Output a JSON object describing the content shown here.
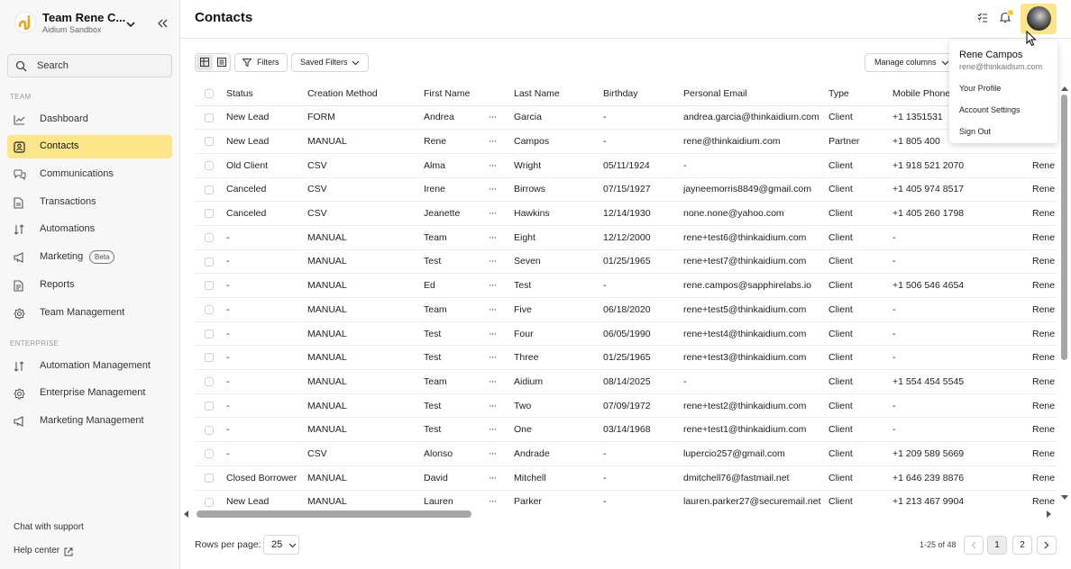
{
  "sidebar": {
    "team_name": "Team Rene C...",
    "team_sub": "Aidium Sandbox",
    "search_placeholder": "Search",
    "section_team": "TEAM",
    "section_enterprise": "ENTERPRISE",
    "items": [
      {
        "label": "Dashboard",
        "icon": "chart-line-icon"
      },
      {
        "label": "Contacts",
        "icon": "contacts-icon",
        "active": true
      },
      {
        "label": "Communications",
        "icon": "chat-icon"
      },
      {
        "label": "Transactions",
        "icon": "document-icon"
      },
      {
        "label": "Automations",
        "icon": "automation-icon"
      },
      {
        "label": "Marketing",
        "icon": "megaphone-icon",
        "badge": "Beta"
      },
      {
        "label": "Reports",
        "icon": "report-icon"
      },
      {
        "label": "Team Management",
        "icon": "gear-icon"
      }
    ],
    "enterprise_items": [
      {
        "label": "Automation Management",
        "icon": "automation-icon"
      },
      {
        "label": "Enterprise Management",
        "icon": "gear-icon"
      },
      {
        "label": "Marketing Management",
        "icon": "megaphone-icon"
      }
    ],
    "chat_support": "Chat with support",
    "help_center": "Help center"
  },
  "header": {
    "title": "Contacts"
  },
  "toolbar": {
    "filters": "Filters",
    "saved_filters": "Saved Filters",
    "manage_columns": "Manage columns"
  },
  "table": {
    "columns": [
      "Status",
      "Creation Method",
      "First Name",
      "Last Name",
      "Birthday",
      "Personal Email",
      "Type",
      "Mobile Phone"
    ],
    "rows": [
      {
        "status": "New Lead",
        "method": "FORM",
        "first": "Andrea",
        "last": "Garcia",
        "birthday": "-",
        "email": "andrea.garcia@thinkaidium.com",
        "type": "Client",
        "phone": "+1 1351531",
        "extra": ""
      },
      {
        "status": "New Lead",
        "method": "MANUAL",
        "first": "Rene",
        "last": "Campos",
        "birthday": "-",
        "email": "rene@thinkaidium.com",
        "type": "Partner",
        "phone": "+1 805 400",
        "extra": ""
      },
      {
        "status": "Old Client",
        "method": "CSV",
        "first": "Alma",
        "last": "Wright",
        "birthday": "05/11/1924",
        "email": "-",
        "type": "Client",
        "phone": "+1 918 521 2070",
        "extra": "Rene"
      },
      {
        "status": "Canceled",
        "method": "CSV",
        "first": "Irene",
        "last": "Birrows",
        "birthday": "07/15/1927",
        "email": "jayneemorris8849@gmail.com",
        "type": "Client",
        "phone": "+1 405 974 8517",
        "extra": "Rene"
      },
      {
        "status": "Canceled",
        "method": "CSV",
        "first": "Jeanette",
        "last": "Hawkins",
        "birthday": "12/14/1930",
        "email": "none.none@yahoo.com",
        "type": "Client",
        "phone": "+1 405 260 1798",
        "extra": "Rene"
      },
      {
        "status": "-",
        "method": "MANUAL",
        "first": "Team",
        "last": "Eight",
        "birthday": "12/12/2000",
        "email": "rene+test6@thinkaidium.com",
        "type": "Client",
        "phone": "-",
        "extra": "Rene"
      },
      {
        "status": "-",
        "method": "MANUAL",
        "first": "Test",
        "last": "Seven",
        "birthday": "01/25/1965",
        "email": "rene+test7@thinkaidium.com",
        "type": "Client",
        "phone": "-",
        "extra": "Rene"
      },
      {
        "status": "-",
        "method": "MANUAL",
        "first": "Ed",
        "last": "Test",
        "birthday": "-",
        "email": "rene.campos@sapphirelabs.io",
        "type": "Client",
        "phone": "+1 506 546 4654",
        "extra": "Rene"
      },
      {
        "status": "-",
        "method": "MANUAL",
        "first": "Team",
        "last": "Five",
        "birthday": "06/18/2020",
        "email": "rene+test5@thinkaidium.com",
        "type": "Client",
        "phone": "-",
        "extra": "Rene"
      },
      {
        "status": "-",
        "method": "MANUAL",
        "first": "Test",
        "last": "Four",
        "birthday": "06/05/1990",
        "email": "rene+test4@thinkaidium.com",
        "type": "Client",
        "phone": "-",
        "extra": "Rene"
      },
      {
        "status": "-",
        "method": "MANUAL",
        "first": "Test",
        "last": "Three",
        "birthday": "01/25/1965",
        "email": "rene+test3@thinkaidium.com",
        "type": "Client",
        "phone": "-",
        "extra": "Rene"
      },
      {
        "status": "-",
        "method": "MANUAL",
        "first": "Team",
        "last": "Aidium",
        "birthday": "08/14/2025",
        "email": "-",
        "type": "Client",
        "phone": "+1 554 454 5545",
        "extra": "Rene"
      },
      {
        "status": "-",
        "method": "MANUAL",
        "first": "Test",
        "last": "Two",
        "birthday": "07/09/1972",
        "email": "rene+test2@thinkaidium.com",
        "type": "Client",
        "phone": "-",
        "extra": "Rene"
      },
      {
        "status": "-",
        "method": "MANUAL",
        "first": "Test",
        "last": "One",
        "birthday": "03/14/1968",
        "email": "rene+test1@thinkaidium.com",
        "type": "Client",
        "phone": "-",
        "extra": "Rene"
      },
      {
        "status": "-",
        "method": "CSV",
        "first": "Alonso",
        "last": "Andrade",
        "birthday": "-",
        "email": "lupercio257@gmail.com",
        "type": "Client",
        "phone": "+1 209 589 5669",
        "extra": "Rene"
      },
      {
        "status": "Closed Borrower",
        "method": "MANUAL",
        "first": "David",
        "last": "Mitchell",
        "birthday": "-",
        "email": "dmitchell76@fastmail.net",
        "type": "Client",
        "phone": "+1 646 239 8876",
        "extra": "Rene"
      },
      {
        "status": "New Lead",
        "method": "MANUAL",
        "first": "Lauren",
        "last": "Parker",
        "birthday": "-",
        "email": "lauren.parker27@securemail.net",
        "type": "Client",
        "phone": "+1 213 467 9904",
        "extra": "Rene"
      }
    ]
  },
  "footer": {
    "rows_per_page_label": "Rows per page:",
    "rows_per_page": "25",
    "range": "1-25 of 48",
    "pages": [
      "1",
      "2"
    ],
    "current_page": "1"
  },
  "user_menu": {
    "name": "Rene Campos",
    "email": "rene@thinkaidium.com",
    "items": [
      "Your Profile",
      "Account Settings",
      "Sign Out"
    ]
  },
  "colors": {
    "accent": "#fde68a",
    "notification": "#facc15"
  }
}
